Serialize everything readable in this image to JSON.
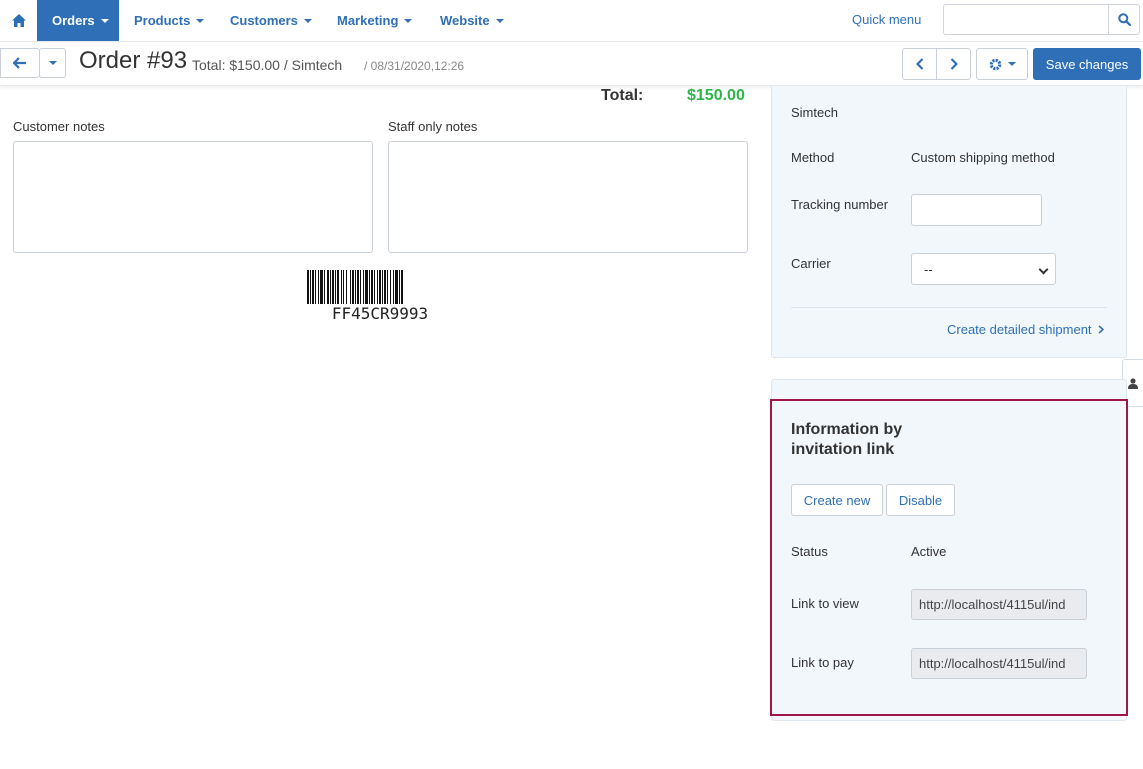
{
  "nav": {
    "items": [
      {
        "label": "Orders",
        "active": true
      },
      {
        "label": "Products"
      },
      {
        "label": "Customers"
      },
      {
        "label": "Marketing"
      },
      {
        "label": "Website"
      }
    ],
    "quick_menu": "Quick menu",
    "search_placeholder": ""
  },
  "order": {
    "title": "Order #93",
    "meta": "Total: $150.00 / Simtech",
    "date": "/ 08/31/2020,12:26",
    "save_label": "Save changes",
    "total_label": "Total:",
    "total_value": "$150.00"
  },
  "notes": {
    "customer_label": "Customer notes",
    "staff_label": "Staff only notes",
    "customer_value": "",
    "staff_value": ""
  },
  "barcode": {
    "text": "FF45CR9993"
  },
  "shipping": {
    "vendor": "Simtech",
    "method_label": "Method",
    "method_value": "Custom shipping method",
    "tracking_label": "Tracking number",
    "tracking_value": "",
    "carrier_label": "Carrier",
    "carrier_value": "--",
    "detailed_link": "Create detailed shipment"
  },
  "invitation": {
    "title": "Information by invitation link",
    "create_label": "Create new",
    "disable_label": "Disable",
    "status_label": "Status",
    "status_value": "Active",
    "view_label": "Link to view",
    "view_url": "http://localhost/4115ul/ind",
    "pay_label": "Link to pay",
    "pay_url": "http://localhost/4115ul/ind"
  },
  "colors": {
    "primary": "#2f6fb7",
    "total": "#2bb54a",
    "panel_bg": "#f2f7fc",
    "highlight": "#a0154a"
  }
}
